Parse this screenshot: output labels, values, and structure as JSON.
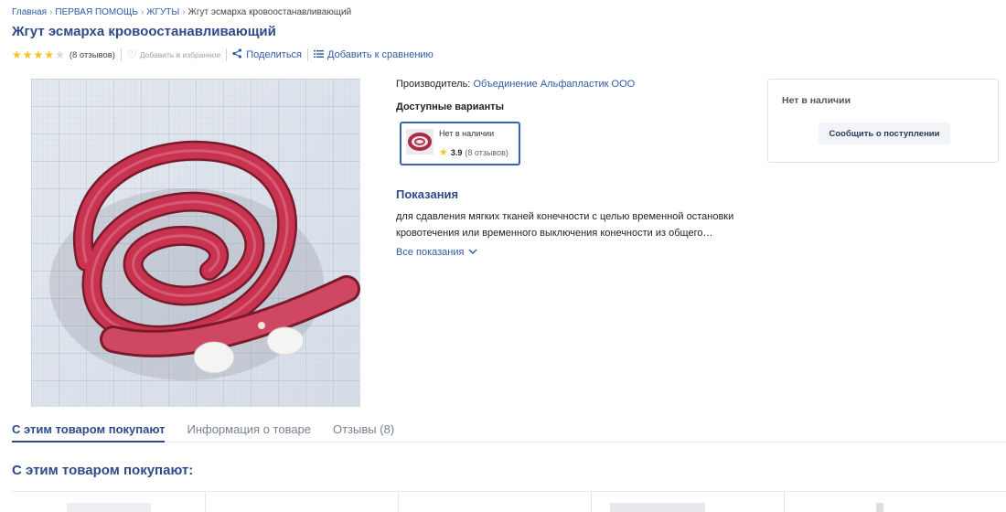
{
  "breadcrumb": {
    "items": [
      "Главная",
      "ПЕРВАЯ ПОМОЩЬ",
      "ЖГУТЫ"
    ],
    "current": "Жгут эсмарха кровоостанавливающий",
    "separator": "›"
  },
  "product": {
    "title": "Жгут эсмарха кровоостанавливающий",
    "rating_stars": 4,
    "reviews_label": "(8 отзывов)",
    "favorite_label": "Добавить в избранное",
    "share_label": "Поделиться",
    "compare_label": "Добавить к сравнению",
    "image_description": "red coiled rubber tourniquet on graph paper"
  },
  "info": {
    "maker_label": "Производитель:",
    "maker_value": "Объединение Альфапластик ООО",
    "variants_title": "Доступные варианты",
    "variant": {
      "status": "Нет в наличии",
      "score": "3.9",
      "reviews": "(8 отзывов)"
    },
    "indications_title": "Показания",
    "indications_text": "для сдавления мягких тканей конечности с целью временной остановки кровотечения или временного выключения конечности из общего…",
    "all_indications_label": "Все показания"
  },
  "stock": {
    "status": "Нет в наличии",
    "notify_label": "Сообщить о поступлении"
  },
  "tabs": [
    {
      "label": "С этим товаром покупают",
      "active": true
    },
    {
      "label": "Информация о товаре",
      "active": false
    },
    {
      "label": "Отзывы (8)",
      "active": false
    }
  ],
  "related": {
    "title": "С этим товаром покупают:"
  },
  "colors": {
    "accent": "#2d4a8a",
    "link": "#2f5aa5",
    "star": "#ffc21a",
    "tourniquet": "#c8344f"
  },
  "icons": {
    "star": "star-icon",
    "heart": "heart-icon",
    "share": "share-icon",
    "compare": "compare-list-icon",
    "chevron": "chevron-down-icon"
  }
}
